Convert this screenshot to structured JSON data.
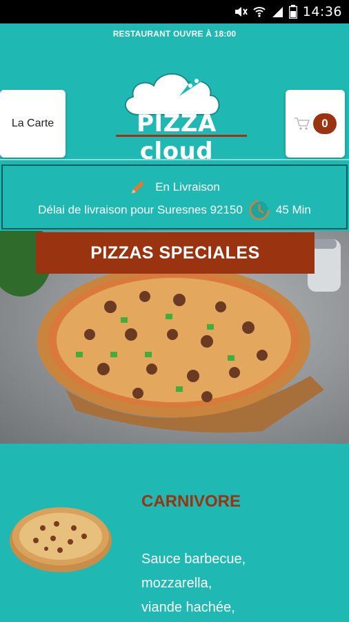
{
  "status_bar": {
    "time": "14:36"
  },
  "header": {
    "open_banner": "RESTAURANT OUVRE À 18:00",
    "menu_button": "La Carte",
    "cart_count": "0",
    "logo_text": "PIZZA cloud"
  },
  "delivery": {
    "mode": "En Livraison",
    "delay_label": "Délai de livraison pour Suresnes 92150",
    "delay_value": "45 Min"
  },
  "hero": {
    "category_title": "PIZZAS SPECIALES"
  },
  "product": {
    "name": "CARNIVORE",
    "description_lines": [
      "Sauce barbecue,",
      "mozzarella,",
      "viande hachée,"
    ]
  },
  "colors": {
    "teal": "#1fb8b3",
    "brand_rust": "#9a3410",
    "border_dark": "#0f5f60"
  },
  "icons": [
    "mute-icon",
    "wifi-icon",
    "signal-icon",
    "battery-icon",
    "cart-icon",
    "pencil-icon",
    "clock-icon"
  ]
}
